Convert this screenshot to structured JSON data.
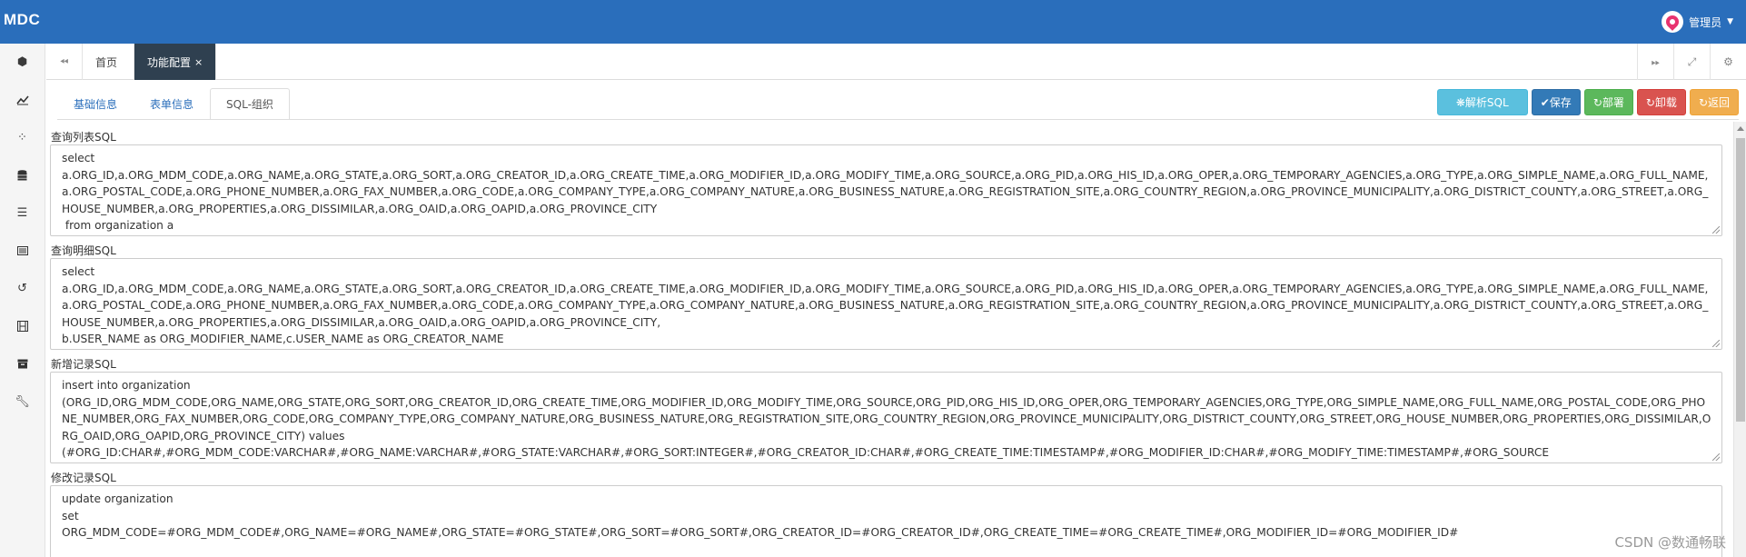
{
  "app": {
    "brand": "MDC",
    "user_name": "管理员"
  },
  "page_tabs": [
    {
      "label": "首页"
    },
    {
      "label": "功能配置",
      "close": "×"
    }
  ],
  "sub_tabs": [
    {
      "label": "基础信息"
    },
    {
      "label": "表单信息"
    },
    {
      "label": "SQL-组织"
    }
  ],
  "actions": {
    "parse": "❋解析SQL",
    "save": "✔保存",
    "deploy": "↻部署",
    "uninstall": "↻卸载",
    "back": "↻返回"
  },
  "fields": [
    {
      "label": "查询列表SQL",
      "value": "select\na.ORG_ID,a.ORG_MDM_CODE,a.ORG_NAME,a.ORG_STATE,a.ORG_SORT,a.ORG_CREATOR_ID,a.ORG_CREATE_TIME,a.ORG_MODIFIER_ID,a.ORG_MODIFY_TIME,a.ORG_SOURCE,a.ORG_PID,a.ORG_HIS_ID,a.ORG_OPER,a.ORG_TEMPORARY_AGENCIES,a.ORG_TYPE,a.ORG_SIMPLE_NAME,a.ORG_FULL_NAME,a.ORG_POSTAL_CODE,a.ORG_PHONE_NUMBER,a.ORG_FAX_NUMBER,a.ORG_CODE,a.ORG_COMPANY_TYPE,a.ORG_COMPANY_NATURE,a.ORG_BUSINESS_NATURE,a.ORG_REGISTRATION_SITE,a.ORG_COUNTRY_REGION,a.ORG_PROVINCE_MUNICIPALITY,a.ORG_DISTRICT_COUNTY,a.ORG_STREET,a.ORG_HOUSE_NUMBER,a.ORG_PROPERTIES,a.ORG_DISSIMILAR,a.ORG_OAID,a.ORG_OAPID,a.ORG_PROVINCE_CITY\n from organization a"
    },
    {
      "label": "查询明细SQL",
      "value": "select\na.ORG_ID,a.ORG_MDM_CODE,a.ORG_NAME,a.ORG_STATE,a.ORG_SORT,a.ORG_CREATOR_ID,a.ORG_CREATE_TIME,a.ORG_MODIFIER_ID,a.ORG_MODIFY_TIME,a.ORG_SOURCE,a.ORG_PID,a.ORG_HIS_ID,a.ORG_OPER,a.ORG_TEMPORARY_AGENCIES,a.ORG_TYPE,a.ORG_SIMPLE_NAME,a.ORG_FULL_NAME,a.ORG_POSTAL_CODE,a.ORG_PHONE_NUMBER,a.ORG_FAX_NUMBER,a.ORG_CODE,a.ORG_COMPANY_TYPE,a.ORG_COMPANY_NATURE,a.ORG_BUSINESS_NATURE,a.ORG_REGISTRATION_SITE,a.ORG_COUNTRY_REGION,a.ORG_PROVINCE_MUNICIPALITY,a.ORG_DISTRICT_COUNTY,a.ORG_STREET,a.ORG_HOUSE_NUMBER,a.ORG_PROPERTIES,a.ORG_DISSIMILAR,a.ORG_OAID,a.ORG_OAPID,a.ORG_PROVINCE_CITY,\nb.USER_NAME as ORG_MODIFIER_NAME,c.USER_NAME as ORG_CREATOR_NAME"
    },
    {
      "label": "新增记录SQL",
      "value": "insert into organization\n(ORG_ID,ORG_MDM_CODE,ORG_NAME,ORG_STATE,ORG_SORT,ORG_CREATOR_ID,ORG_CREATE_TIME,ORG_MODIFIER_ID,ORG_MODIFY_TIME,ORG_SOURCE,ORG_PID,ORG_HIS_ID,ORG_OPER,ORG_TEMPORARY_AGENCIES,ORG_TYPE,ORG_SIMPLE_NAME,ORG_FULL_NAME,ORG_POSTAL_CODE,ORG_PHONE_NUMBER,ORG_FAX_NUMBER,ORG_CODE,ORG_COMPANY_TYPE,ORG_COMPANY_NATURE,ORG_BUSINESS_NATURE,ORG_REGISTRATION_SITE,ORG_COUNTRY_REGION,ORG_PROVINCE_MUNICIPALITY,ORG_DISTRICT_COUNTY,ORG_STREET,ORG_HOUSE_NUMBER,ORG_PROPERTIES,ORG_DISSIMILAR,ORG_OAID,ORG_OAPID,ORG_PROVINCE_CITY) values\n(#ORG_ID:CHAR#,#ORG_MDM_CODE:VARCHAR#,#ORG_NAME:VARCHAR#,#ORG_STATE:VARCHAR#,#ORG_SORT:INTEGER#,#ORG_CREATOR_ID:CHAR#,#ORG_CREATE_TIME:TIMESTAMP#,#ORG_MODIFIER_ID:CHAR#,#ORG_MODIFY_TIME:TIMESTAMP#,#ORG_SOURCE"
    },
    {
      "label": "修改记录SQL",
      "value": "update organization\nset\nORG_MDM_CODE=#ORG_MDM_CODE#,ORG_NAME=#ORG_NAME#,ORG_STATE=#ORG_STATE#,ORG_SORT=#ORG_SORT#,ORG_CREATOR_ID=#ORG_CREATOR_ID#,ORG_CREATE_TIME=#ORG_CREATE_TIME#,ORG_MODIFIER_ID=#ORG_MODIFIER_ID#"
    }
  ],
  "watermark": "CSDN @数通畅联",
  "icons": {
    "sidebar": [
      "cube-icon",
      "line-chart-icon",
      "spinner-icon",
      "database-icon",
      "list-icon",
      "list-alt-icon",
      "history-icon",
      "film-icon",
      "archive-icon",
      "wrench-icon"
    ],
    "tabbar": [
      "backward-icon",
      "forward-icon",
      "fullscreen-icon",
      "gear-icon"
    ]
  },
  "colors": {
    "navbar": "#2a6ebb",
    "active_tab": "#2f4050"
  }
}
